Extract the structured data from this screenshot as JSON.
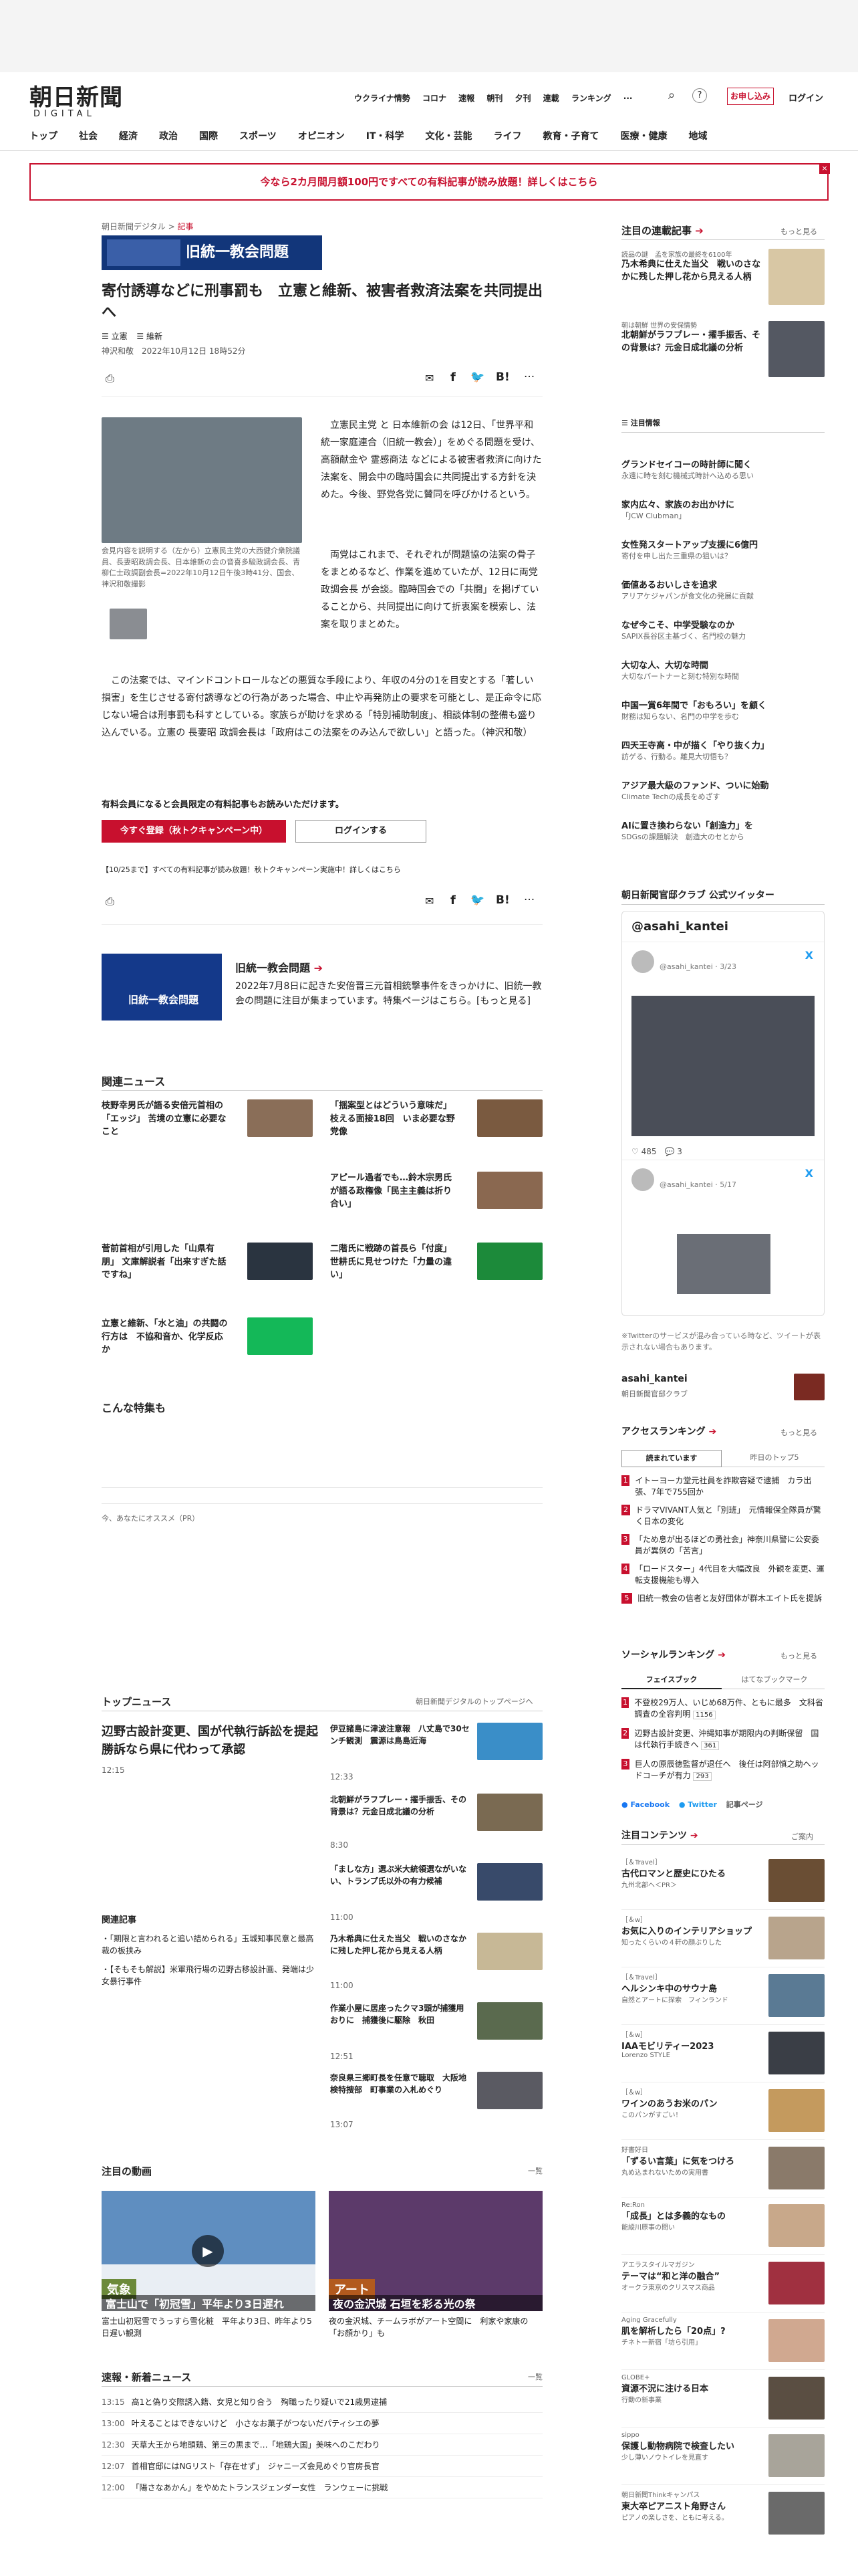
{
  "header": {
    "logo_text": "朝日新聞",
    "logo_sub": "DIGITAL",
    "top_links": [
      "ウクライナ情勢",
      "コロナ",
      "速報",
      "朝刊",
      "夕刊",
      "連載",
      "ランキング"
    ],
    "signup": "お申し込み",
    "login": "ログイン"
  },
  "nav": [
    "トップ",
    "社会",
    "経済",
    "政治",
    "国際",
    "スポーツ",
    "オピニオン",
    "IT・科学",
    "文化・芸能",
    "ライフ",
    "教育・子育て",
    "医療・健康",
    "地域"
  ],
  "banner": "今なら2カ月間月額100円ですべての有料記事が読み放題！詳しくはこちら",
  "article": {
    "breadcrumb": [
      "朝日新聞デジタル",
      "記事"
    ],
    "series": "旧統一教会問題",
    "title": "寄付誘導などに刑事罰も　立憲と維新、被害者救済法案を共同提出へ",
    "tags": [
      "立憲",
      "維新"
    ],
    "byline": "神沢和敬",
    "date": "2022年10月12日 18時52分",
    "photo_caption": "会見内容を説明する（左から）立憲民主党の大西健介衆院議員、長妻昭政調会長、日本維新の会の音喜多駿政調会長、青柳仁士政調副会長=2022年10月12日午後3時41分、国会、神沢和敬撮影",
    "para1": "立憲民主党 と 日本維新の会 は12日、「世界平和統一家庭連合（旧統一教会）」をめぐる問題を受け、高額献金や 霊感商法 などによる被害者救済に向けた法案を、開会中の臨時国会に共同提出する方針を決めた。今後、野党各党に賛同を呼びかけるという。",
    "para2": "両党はこれまで、それぞれが問題協の法案の骨子をまとめるなど、作業を進めていたが、12日に両党 政調会長 が会談。臨時国会での「共闘」を掲げていることから、共同提出に向けて折衷案を模索し、法案を取りまとめた。",
    "para3": "この法案では、マインドコントロールなどの悪質な手段により、年収の4分の1を目安とする「著しい損害」を生じさせる寄付誘導などの行為があった場合、中止や再発防止の要求を可能とし、是正命令に応じない場合は刑事罰も科すとしている。家族らが助けを求める「特別補助制度」、相談体制の整備も盛り込んでいる。立憲の 長妻昭 政調会長は「政府はこの法案をのみ込んで欲しい」と語った。（神沢和敬）",
    "members_note": "有料会員になると会員限定の有料記事もお読みいただけます。",
    "register": "今すぐ登録（秋トクキャンペーン中）",
    "login_btn": "ログインする",
    "campaign": "【10/25まで】すべての有料記事が読み放題！秋トクキャンペーン実施中！詳しくはこちら",
    "feature_title": "旧統一教会問題",
    "feature_body": "2022年7月8日に起きた安倍晋三元首相銃撃事件をきっかけに、旧統一教会の問題に注目が集まっています。特集ページはこちら。[もっと見る]"
  },
  "related": {
    "heading": "関連ニュース",
    "items": [
      "枝野幸男氏が語る安倍元首相の「エッジ」 苦境の立憲に必要なこと",
      "「揺案型とはどういう意味だ」枝える面接18回　いま必要な野党像",
      "アピール過者でも…鈴木宗男氏が語る政権像「民主主義は折り合い」",
      "菅前首相が引用した「山県有朋」 文庫解説者「出来すぎた話ですね」",
      "二階氏に戦跡の首長ら「付度」 世耕氏に見せつけた「力量の違い」",
      "立憲と維新、「水と油」の共闘の行方は　不協和音か、化学反応か"
    ]
  },
  "special": "こんな特集も",
  "recommend": "今、あなたにオススメ（PR）",
  "top_news": {
    "heading": "トップニュース",
    "link": "朝日新聞デジタルのトップページへ",
    "lead": "辺野古設計変更、国が代執行訴訟を提起　勝訴なら県に代わって承認",
    "lead_time": "12:15",
    "items": [
      {
        "t": "伊豆諸島に津波注意報　八丈島で30センチ観測　震源は鳥島近海",
        "time": "12:33"
      },
      {
        "t": "北朝鮮がラフプレー・擢手振舌、その背景は？元金日成北議の分析",
        "time": "8:30"
      },
      {
        "t": "「ましな方」選ぶ米大統領選ながいない、トランプ氏以外の有力候補",
        "time": "11:00"
      },
      {
        "t": "乃木希典に仕えた当父　戦いのさなかに残した押し花から見える人柄",
        "time": "11:00"
      },
      {
        "t": "作業小屋に居座ったクマ3頭が捕獲用おりに　捕獲後に駆除　秋田",
        "time": "12:51"
      },
      {
        "t": "奈良県三郷町長を任意で聴取　大阪地検特捜部　町事業の入札めぐり",
        "time": "13:07"
      }
    ],
    "related_head": "関連記事",
    "related": [
      "「期限と言われると追い詰められる」玉城知事民意と最高裁の板挟み",
      "【そもそも解説】米軍飛行場の辺野古移設計画、発端は少女暴行事件"
    ]
  },
  "videos": {
    "heading": "注目の動画",
    "link": "一覧",
    "items": [
      {
        "label": "気象",
        "cap": "富士山で「初冠雪」平年より3日遅れ",
        "desc": "富士山初冠雪でうっすら雪化粧　平年より3日、昨年より5日遅い観測"
      },
      {
        "label": "アート",
        "cap": "夜の金沢城 石垣を彩る光の祭",
        "desc": "夜の金沢城、チームラボがアート空間に　利家や家康の「お顔かり」も"
      }
    ]
  },
  "breaking": {
    "heading": "速報・新着ニュース",
    "link": "一覧",
    "items": [
      {
        "time": "13:15",
        "t": "高1と偽り交際誘入籍、女児と知り合う　殉職ったり疑いで21歳男逮捕"
      },
      {
        "time": "13:00",
        "t": "叶えることはできないけど　小さなお菓子がつないだパティシエの夢"
      },
      {
        "time": "12:30",
        "t": "天草大王から地頭鶏、第三の黒まで…「地鶏大国」美味へのこだわり"
      },
      {
        "time": "12:07",
        "t": "首相官邸にはNGリスト「存在せず」　ジャニーズ会見めぐり官房長官"
      },
      {
        "time": "12:00",
        "t": "「陽さなあかん」をやめたトランスジェンダー女性　ランウェーに挑戦"
      }
    ]
  },
  "sidebar": {
    "series_head": "注目の連載記事",
    "more": "もっと見る",
    "series": [
      {
        "tag": "読品の謎　孟を家族の最終を6100年",
        "t": "乃木希典に仕えた当父　戦いのさなかに残した押し花から見える人柄"
      },
      {
        "tag": "朝は朝鮮 世界の安保情勢",
        "t": "北朝鮮がラフプレー・擢手振舌、その背景は？元金日成北議の分析"
      }
    ],
    "pick_head": "注目情報",
    "picks": [
      {
        "t": "グランドセイコーの時計師に聞く",
        "s": "永遠に時を刻む機械式時計へ込める思い"
      },
      {
        "t": "家内広々、家族のお出かけに",
        "s": "「JCW Clubman」"
      },
      {
        "t": "女性発スタートアップ支援に6億円",
        "s": "寄付を申し出た三重県の狙いは？"
      },
      {
        "t": "価値あるおいしさを追求",
        "s": "アリアケジャパンが食文化の発展に貢献"
      },
      {
        "t": "なぜ今こそ、中学受験なのか",
        "s": "SAPIX長谷区主基づく、名門校の魅力"
      },
      {
        "t": "大切な人、大切な時間",
        "s": "大切なパートナーと刻む特別な時間"
      },
      {
        "t": "中国一賞6年間で「おもろい」を顧く",
        "s": "財務は知らない、名門の中学を歩む"
      },
      {
        "t": "四天王寺高・中が描く「やり抜く力」",
        "s": "訪ゲる、行動る。離見大切悟も？"
      },
      {
        "t": "アジア最大級のファンド、ついに始動",
        "s": "Climate Techの成長をめざす"
      },
      {
        "t": "AIに置き換わらない「創造力」を",
        "s": "SDGsの課題解決　創造大のセとから"
      }
    ],
    "club_head": "朝日新聞官邸クラブ 公式ツイッター",
    "twitter_handle": "@asahi_kantei",
    "tweet_user": "@asahi_kantei",
    "tweet_time": "3/23",
    "tweet_count": "485",
    "tweet_reply": "3",
    "tweet2_time": "5/17",
    "twitter_note": "※Twitterのサービスが混み合っている時など、ツイートが表示されない場合もあります。",
    "club_name": "asahi_kantei",
    "club_sub": "朝日新聞官邸クラブ",
    "rank_head": "アクセスランキング",
    "rank_tabs": [
      "読まれています",
      "昨日のトップ5"
    ],
    "ranks": [
      "イトーヨーカ堂元社員を詐欺容疑で逮捕　カラ出張、7年で755回か",
      "ドラマVIVANT人気と「別班」　元情報保全隊員が驚く日本の変化",
      "「ため息が出るほどの勇社会」神奈川県警に公安委員が異例の「苦言」",
      "「ロードスター」4代目を大幅改良　外観を変更、運転支援機能も導入",
      "旧統一教会の信者と友好団体が群木エイト氏を提訴"
    ],
    "social_head": "ソーシャルランキング",
    "social_tabs": [
      "フェイスブック",
      "はてなブックマーク"
    ],
    "socials": [
      {
        "t": "不登校29万人、いじめ68万件、ともに最多　文科省調査の全容判明",
        "n": "1156"
      },
      {
        "t": "辺野古設計変更、沖縄知事が期限内の判断保留　国は代執行手続きへ",
        "n": "361"
      },
      {
        "t": "巨人の原辰徳監督が退任へ　後任は阿部慎之助ヘッドコーチが有力",
        "n": "293"
      }
    ],
    "fb": "Facebook",
    "tw": "Twitter",
    "share": "記事ページ",
    "content_head": "注目コンテンツ",
    "content_more": "ご案内",
    "contents": [
      {
        "tag": "［＆Travel］",
        "t": "古代ロマンと歴史にひたる",
        "s": "九州北部へ＜PR＞"
      },
      {
        "tag": "［＆w］",
        "t": "お気に入りのインテリアショップ",
        "s": "知ったくらいの４軒の顔ぶりした"
      },
      {
        "tag": "［＆Travel］",
        "t": "ヘルシンキ中のサウナ島",
        "s": "自然とアートに探索　フィンランド"
      },
      {
        "tag": "［＆w］",
        "t": "IAAモビリティー2023",
        "s": "Lorenzo STYLE"
      },
      {
        "tag": "［＆w］",
        "t": "ワインのあうお米のパン",
        "s": "このパンがすごい！"
      },
      {
        "tag": "好書好日",
        "t": "「ずるい言葉」に気をつけろ",
        "s": "丸め込まれないための実用書"
      },
      {
        "tag": "Re:Ron",
        "t": "「成長」とは多義的なもの",
        "s": "能縦川原事の問い"
      },
      {
        "tag": "アエラスタイルマガジン",
        "t": "テーマは“和と洋の融合”",
        "s": "オークラ東京のクリスマス商品"
      },
      {
        "tag": "Aging Gracefully",
        "t": "肌を解析したら「20点」?",
        "s": "チネトー新宿「坊ら引用」"
      },
      {
        "tag": "GLOBE+",
        "t": "資源不況に注ける日本",
        "s": "行動の新事業"
      },
      {
        "tag": "sippo",
        "t": "保護し動物病院で検査したい",
        "s": "少し薄いノウトイレを見直す"
      },
      {
        "tag": "朝日新聞Thinkキャンパス",
        "t": "東大卒ピアニスト角野さん",
        "s": "ピアノの楽しさを、ともに考える。"
      }
    ]
  }
}
